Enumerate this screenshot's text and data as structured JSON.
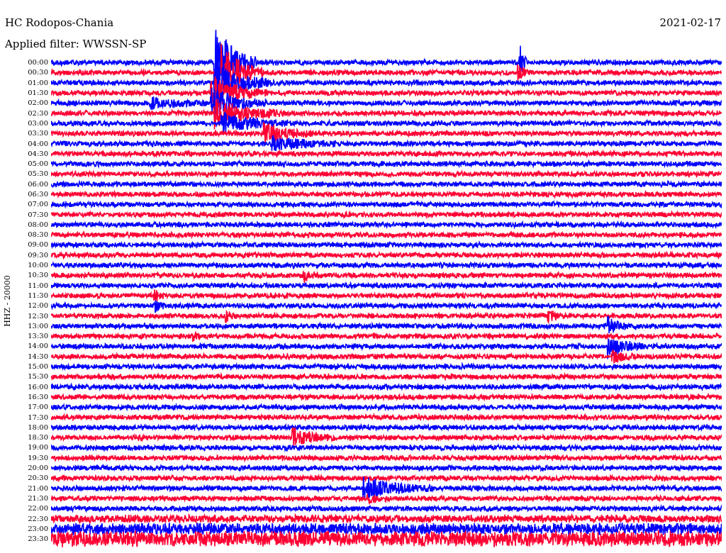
{
  "header": {
    "station": "HC Rodopos-Chania",
    "date": "2021-02-17",
    "filter": "Applied filter: WWSSN-SP"
  },
  "axis_label": "HHZ - 20000",
  "traces": [
    {
      "time": "00:00",
      "color": "#0000ff"
    },
    {
      "time": "00:30",
      "color": "#ff0033"
    },
    {
      "time": "01:00",
      "color": "#0000ff"
    },
    {
      "time": "01:30",
      "color": "#ff0033"
    },
    {
      "time": "02:00",
      "color": "#0000ff"
    },
    {
      "time": "02:30",
      "color": "#ff0033"
    },
    {
      "time": "03:00",
      "color": "#0000ff"
    },
    {
      "time": "03:30",
      "color": "#ff0033"
    },
    {
      "time": "04:00",
      "color": "#0000ff"
    },
    {
      "time": "04:30",
      "color": "#ff0033"
    },
    {
      "time": "05:00",
      "color": "#0000ff"
    },
    {
      "time": "05:30",
      "color": "#ff0033"
    },
    {
      "time": "06:00",
      "color": "#0000ff"
    },
    {
      "time": "06:30",
      "color": "#ff0033"
    },
    {
      "time": "07:00",
      "color": "#0000ff"
    },
    {
      "time": "07:30",
      "color": "#ff0033"
    },
    {
      "time": "08:00",
      "color": "#0000ff"
    },
    {
      "time": "08:30",
      "color": "#ff0033"
    },
    {
      "time": "09:00",
      "color": "#0000ff"
    },
    {
      "time": "09:30",
      "color": "#ff0033"
    },
    {
      "time": "10:00",
      "color": "#0000ff"
    },
    {
      "time": "10:30",
      "color": "#ff0033"
    },
    {
      "time": "11:00",
      "color": "#0000ff"
    },
    {
      "time": "11:30",
      "color": "#ff0033"
    },
    {
      "time": "12:00",
      "color": "#0000ff"
    },
    {
      "time": "12:30",
      "color": "#ff0033"
    },
    {
      "time": "13:00",
      "color": "#0000ff"
    },
    {
      "time": "13:30",
      "color": "#ff0033"
    },
    {
      "time": "14:00",
      "color": "#0000ff"
    },
    {
      "time": "14:30",
      "color": "#ff0033"
    },
    {
      "time": "15:00",
      "color": "#0000ff"
    },
    {
      "time": "15:30",
      "color": "#ff0033"
    },
    {
      "time": "16:00",
      "color": "#0000ff"
    },
    {
      "time": "16:30",
      "color": "#ff0033"
    },
    {
      "time": "17:00",
      "color": "#0000ff"
    },
    {
      "time": "17:30",
      "color": "#ff0033"
    },
    {
      "time": "18:00",
      "color": "#0000ff"
    },
    {
      "time": "18:30",
      "color": "#ff0033"
    },
    {
      "time": "19:00",
      "color": "#0000ff"
    },
    {
      "time": "19:30",
      "color": "#ff0033"
    },
    {
      "time": "20:00",
      "color": "#0000ff"
    },
    {
      "time": "20:30",
      "color": "#ff0033"
    },
    {
      "time": "21:00",
      "color": "#0000ff"
    },
    {
      "time": "21:30",
      "color": "#ff0033"
    },
    {
      "time": "22:00",
      "color": "#0000ff"
    },
    {
      "time": "22:30",
      "color": "#ff0033"
    },
    {
      "time": "23:00",
      "color": "#0000ff"
    },
    {
      "time": "23:30",
      "color": "#ff0033"
    }
  ]
}
